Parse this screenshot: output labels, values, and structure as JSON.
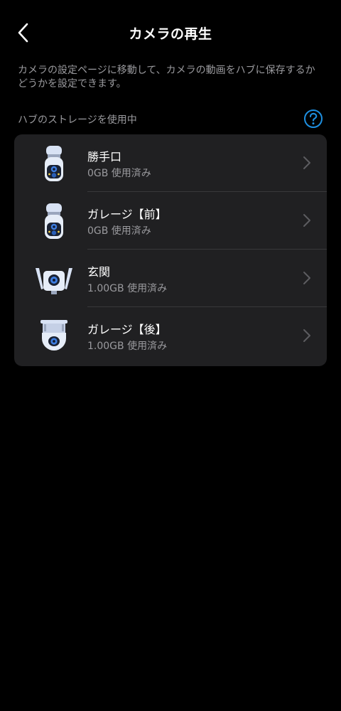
{
  "header": {
    "title": "カメラの再生",
    "back_icon": "chevron-left-icon"
  },
  "description": "カメラの設定ページに移動して、カメラの動画をハブに保存するかどうかを設定できます。",
  "section": {
    "title": "ハブのストレージを使用中",
    "help_icon": "question-circle-icon",
    "help_color": "#1e8fe0"
  },
  "cameras": [
    {
      "name": "勝手口",
      "usage": "0GB 使用済み",
      "icon": "bullet-camera-icon"
    },
    {
      "name": "ガレージ【前】",
      "usage": "0GB 使用済み",
      "icon": "bullet-camera-icon"
    },
    {
      "name": "玄関",
      "usage": "1.00GB 使用済み",
      "icon": "antenna-camera-icon"
    },
    {
      "name": "ガレージ【後】",
      "usage": "1.00GB 使用済み",
      "icon": "pan-tilt-camera-icon"
    }
  ],
  "colors": {
    "background": "#000000",
    "card": "#202022",
    "secondary_text": "#9a9a9e",
    "accent": "#1e8fe0"
  }
}
